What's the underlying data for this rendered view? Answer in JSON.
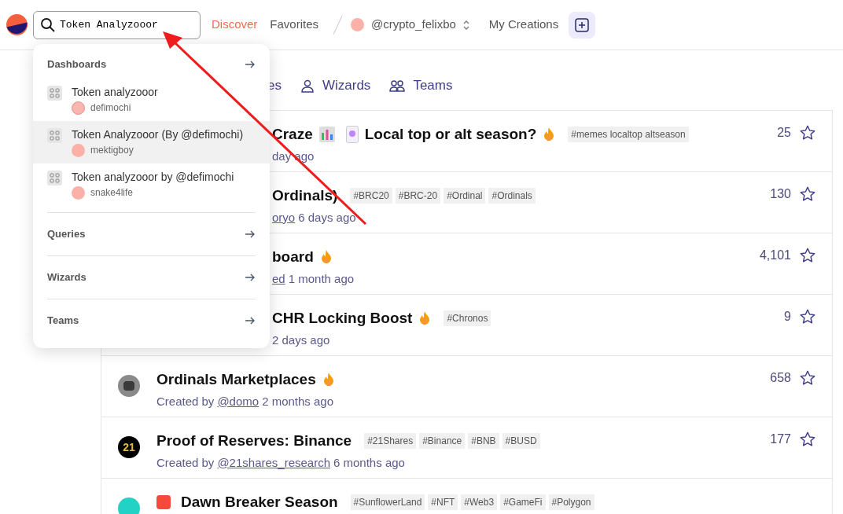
{
  "header": {
    "search": {
      "value": "Token Analyzooor"
    },
    "nav": [
      {
        "label": "Discover",
        "selected": true
      },
      {
        "label": "Favorites",
        "selected": false
      }
    ],
    "account": "@crypto_felixbo",
    "my_creations": "My Creations"
  },
  "search_dropdown": {
    "sections": [
      {
        "title": "Dashboards",
        "items": [
          {
            "title": "Token analyzooor",
            "author": "defimochi",
            "kind": "face",
            "selected": false
          },
          {
            "title": "Token Analyzooor (By @defimochi)",
            "author": "mektigboy",
            "kind": "dot",
            "selected": true
          },
          {
            "title": "Token analyzooor by @defimochi",
            "author": "snake4life",
            "kind": "dot",
            "selected": false
          }
        ]
      },
      {
        "title": "Queries"
      },
      {
        "title": "Wizards"
      },
      {
        "title": "Teams"
      }
    ]
  },
  "tabs": [
    {
      "label": "es",
      "kind": "plain"
    },
    {
      "label": "Wizards",
      "kind": "user"
    },
    {
      "label": "Teams",
      "kind": "users"
    }
  ],
  "rows": [
    {
      "title_segments": [
        "Craze",
        "Local top or alt season?"
      ],
      "hot": true,
      "tags": [
        "#memes localtop altseason"
      ],
      "time": "day ago",
      "stars": "25",
      "covered": true
    },
    {
      "title_segments": [
        "Ordinals)"
      ],
      "hot": false,
      "tags": [
        "#BRC20",
        "#BRC-20",
        "#Ordinal",
        "#Ordinals"
      ],
      "author": "oryo",
      "time": "6 days ago",
      "stars": "130",
      "covered": true
    },
    {
      "title_segments": [
        "board"
      ],
      "hot": true,
      "tags": [],
      "author": "ed",
      "time": "1 month ago",
      "stars": "4,101",
      "covered": true
    },
    {
      "title_segments": [
        "CHR Locking Boost"
      ],
      "hot": true,
      "tags": [
        "#Chronos"
      ],
      "time": "2 days ago",
      "stars": "9",
      "covered": true
    },
    {
      "title_segments": [
        "Ordinals Marketplaces"
      ],
      "hot": true,
      "tags": [],
      "by": "Created by",
      "author": "@domo",
      "time": "2 months ago",
      "stars": "658",
      "kind": "robot"
    },
    {
      "title_segments": [
        "Proof of Reserves: Binance"
      ],
      "hot": false,
      "tags": [
        "#21Shares",
        "#Binance",
        "#BNB",
        "#BUSD"
      ],
      "by": "Created by",
      "author": "@21shares_research",
      "time": "6 months ago",
      "stars": "177",
      "kind": "logo",
      "avatar_text": "21"
    },
    {
      "title_segments": [
        "Dawn Breaker Season"
      ],
      "hot": false,
      "tags": [
        "#SunflowerLand",
        "#NFT",
        "#Web3",
        "#GameFi",
        "#Polygon"
      ],
      "lead_icon": true,
      "kind": "teal"
    }
  ]
}
